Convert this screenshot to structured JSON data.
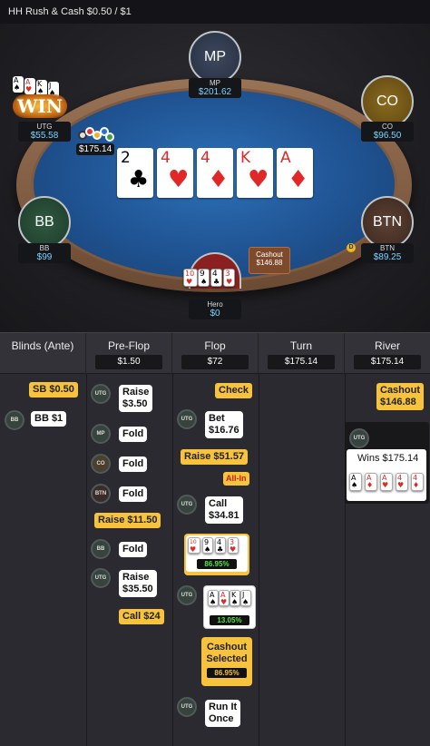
{
  "header": {
    "title": "HH  Rush & Cash $0.50 / $1"
  },
  "seats": {
    "mp": {
      "label": "MP",
      "name": "MP",
      "stack": "$201.62"
    },
    "co": {
      "label": "CO",
      "name": "CO",
      "stack": "$96.50"
    },
    "utg": {
      "name": "UTG",
      "stack": "$55.58",
      "win_badge": "WIN",
      "pot": "$175.14"
    },
    "bb": {
      "label": "BB",
      "name": "BB",
      "stack": "$99"
    },
    "btn": {
      "label": "BTN",
      "name": "BTN",
      "stack": "$89.25",
      "dealer": "D"
    },
    "hero": {
      "name": "Hero",
      "stack": "$0"
    }
  },
  "utg_hand": [
    {
      "r": "A",
      "s": "♠"
    },
    {
      "r": "A",
      "s": "♥"
    },
    {
      "r": "K",
      "s": "♠"
    },
    {
      "r": "J",
      "s": "♠"
    }
  ],
  "hero_hand": [
    {
      "r": "10",
      "s": "♥"
    },
    {
      "r": "9",
      "s": "♠"
    },
    {
      "r": "4",
      "s": "♣"
    },
    {
      "r": "3",
      "s": "♥"
    }
  ],
  "board": [
    {
      "r": "2",
      "s": "♣"
    },
    {
      "r": "4",
      "s": "♥"
    },
    {
      "r": "4",
      "s": "♦"
    },
    {
      "r": "K",
      "s": "♥"
    },
    {
      "r": "A",
      "s": "♦"
    }
  ],
  "cashout_badge": {
    "label": "Cashout",
    "amount": "$146.88"
  },
  "streets": [
    {
      "title": "Blinds (Ante)",
      "value": ""
    },
    {
      "title": "Pre-Flop",
      "value": "$1.50"
    },
    {
      "title": "Flop",
      "value": "$72"
    },
    {
      "title": "Turn",
      "value": "$175.14"
    },
    {
      "title": "River",
      "value": "$175.14"
    }
  ],
  "blinds": {
    "sb": "SB $0.50",
    "bb_avatar": "BB",
    "bb": "BB $1"
  },
  "preflop": {
    "utg1_avatar": "UTG",
    "utg1_action": "Raise\n$3.50",
    "mp_avatar": "MP",
    "mp_action": "Fold",
    "co_avatar": "CO",
    "co_action": "Fold",
    "btn_avatar": "BTN",
    "btn_action": "Fold",
    "hero_raise": "Raise $11.50",
    "bb_avatar": "BB",
    "bb_action": "Fold",
    "utg2_avatar": "UTG",
    "utg2_action": "Raise\n$35.50",
    "hero_call": "Call $24"
  },
  "flop": {
    "hero_check": "Check",
    "utg1_avatar": "UTG",
    "utg1_action": "Bet\n$16.76",
    "hero_raise": "Raise $51.57",
    "allin": "All-In",
    "utg2_avatar": "UTG",
    "utg2_action": "Call\n$34.81",
    "hero_equity": "86.95%",
    "utg3_avatar": "UTG",
    "utg_equity": "13.05%",
    "cashout_selected": "Cashout\nSelected",
    "cashout_equity": "86.95%",
    "utg4_avatar": "UTG",
    "utg4_action": "Run It\nOnce"
  },
  "river": {
    "hero_cashout": "Cashout\n$146.88",
    "utg_avatar": "UTG",
    "wins": "Wins $175.14"
  },
  "colors": {
    "accent_yellow": "#f7c23c",
    "stack_blue": "#7fd3ff",
    "equity_green": "#5ee04c",
    "card_red": "#e02828"
  }
}
